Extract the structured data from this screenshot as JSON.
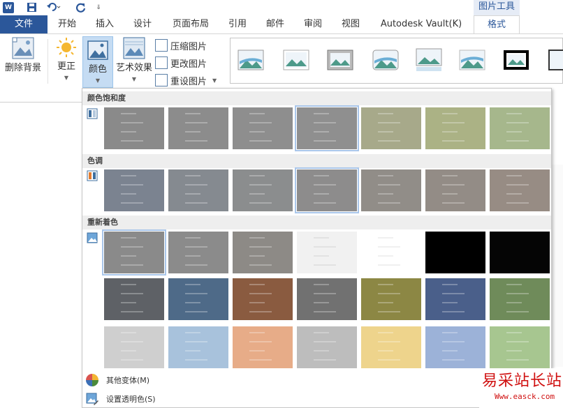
{
  "quick_access": {
    "word_icon": "W",
    "save_icon": "save-icon",
    "undo_icon": "undo-icon",
    "redo_icon": "redo-icon",
    "more": "⇓"
  },
  "context_tools_label": "图片工具",
  "tabs": [
    {
      "label": "文件"
    },
    {
      "label": "开始"
    },
    {
      "label": "插入"
    },
    {
      "label": "设计"
    },
    {
      "label": "页面布局"
    },
    {
      "label": "引用"
    },
    {
      "label": "邮件"
    },
    {
      "label": "审阅"
    },
    {
      "label": "视图"
    },
    {
      "label": "Autodesk Vault(K)"
    },
    {
      "label": "格式"
    }
  ],
  "ribbon": {
    "remove_bg": "删除背景",
    "correct": "更正",
    "color": "颜色",
    "artistic": "艺术效果",
    "compress": "压缩图片",
    "change_pic": "更改图片",
    "reset_pic": "重设图片"
  },
  "dropdown": {
    "sections": [
      {
        "title": "颜色饱和度"
      },
      {
        "title": "色调"
      },
      {
        "title": "重新着色"
      }
    ],
    "menu": {
      "more_variants": "其他变体(M)",
      "set_transparent": "设置透明色(S)"
    },
    "colors": {
      "saturation": [
        "#8a8a8a",
        "#8c8c8c",
        "#8e8e8e",
        "#8f8f8f",
        "#a7a98a",
        "#abb285",
        "#a6b78c"
      ],
      "tone": [
        "#7b8390",
        "#858a90",
        "#8b8d8e",
        "#8d8c8c",
        "#918d88",
        "#938c86",
        "#978c84"
      ],
      "recolor1": [
        "#8a8a8a",
        "#8b8b8b",
        "#8d8a86",
        "#f1f1f1",
        "#ffffff",
        "#000000",
        "#050505"
      ],
      "recolor2": [
        "#5e6166",
        "#4e6a88",
        "#8a5b40",
        "#717171",
        "#8c8744",
        "#4a5f8a",
        "#6f8b5a"
      ],
      "recolor3": [
        "#cfcfcf",
        "#a8c2dc",
        "#e7ac88",
        "#bdbdbd",
        "#eed48c",
        "#9cb2d8",
        "#a7c690"
      ]
    },
    "selected_cells": {
      "saturation": 3,
      "tone": 3,
      "recolor1": 0
    }
  },
  "watermark": {
    "text": "易采站长站",
    "url": "Www.easck.com"
  }
}
